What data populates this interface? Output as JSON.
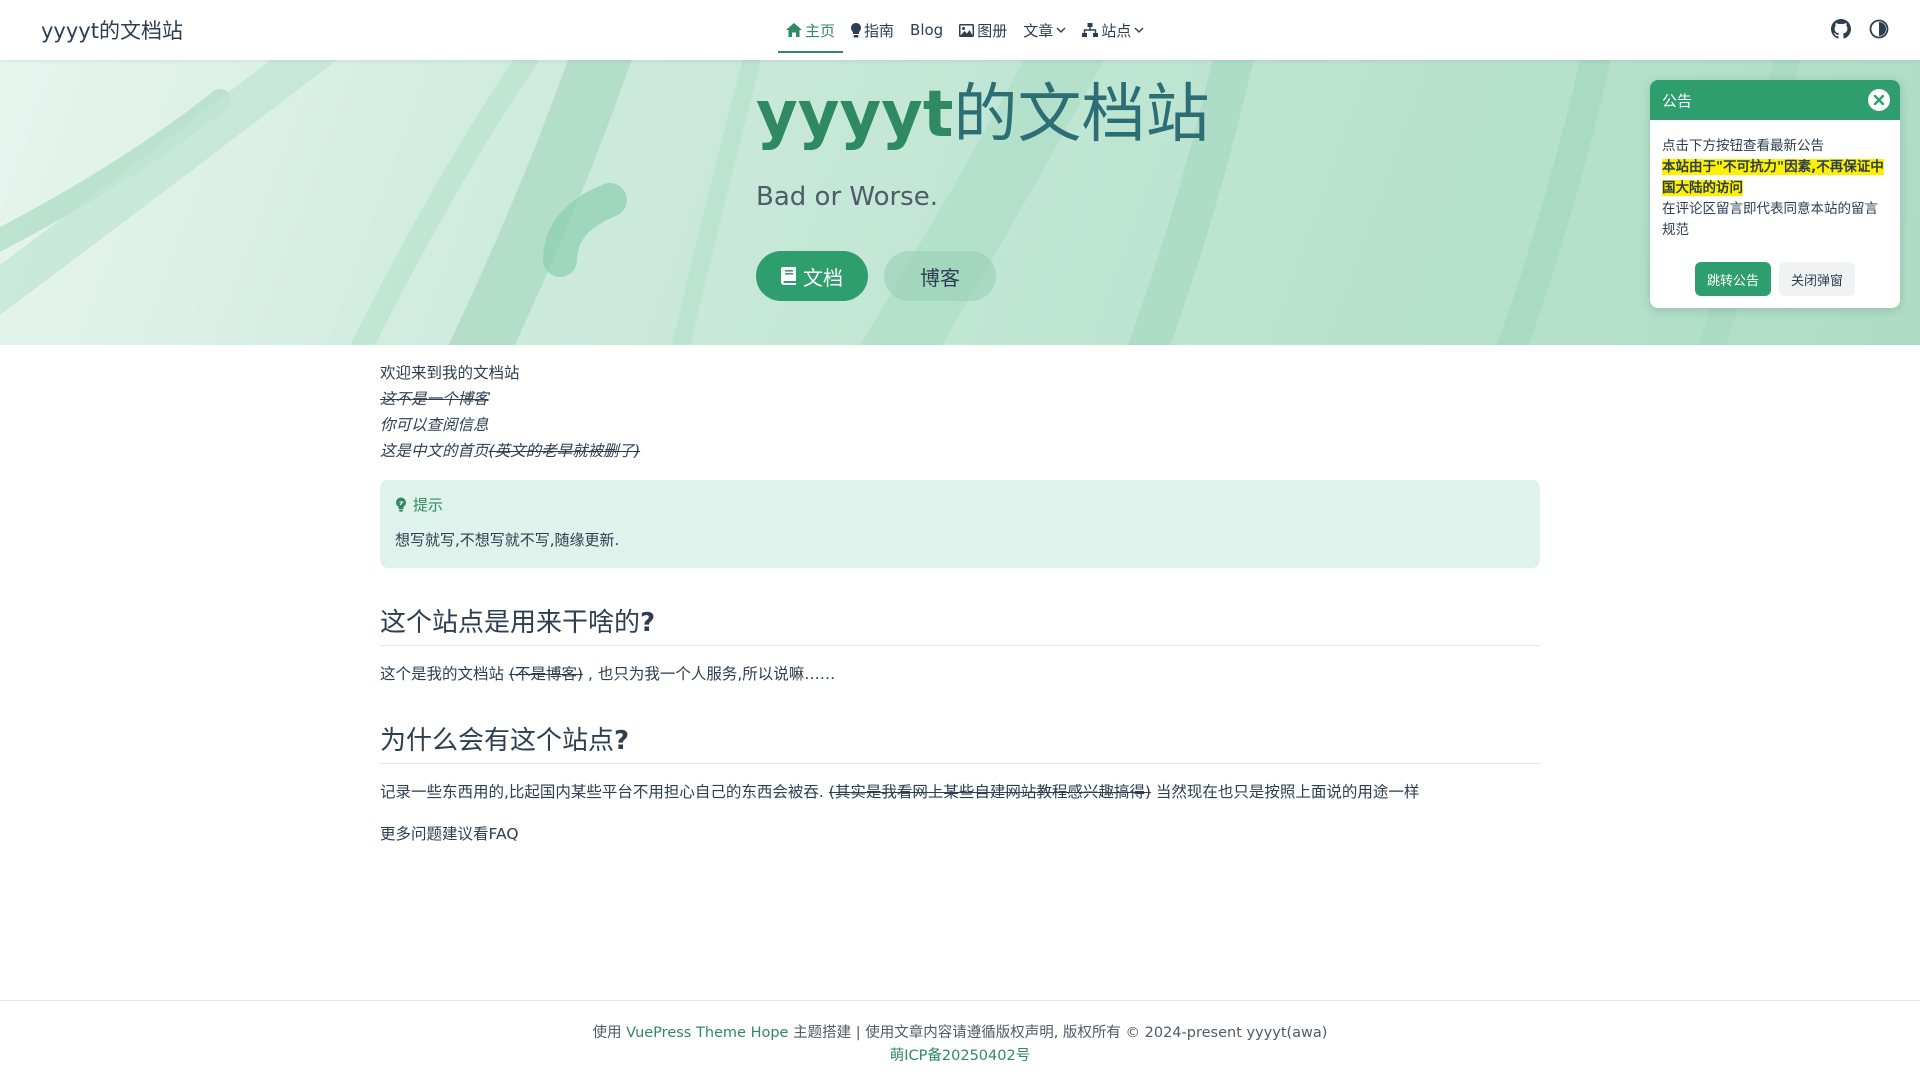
{
  "navbar": {
    "brand": "yyyyt的文档站",
    "items": [
      {
        "label": "主页",
        "icon": "home-icon",
        "active": true
      },
      {
        "label": "指南",
        "icon": "lightbulb-icon"
      },
      {
        "label": "Blog"
      },
      {
        "label": "图册",
        "icon": "image-icon"
      },
      {
        "label": "文章",
        "dropdown": true
      },
      {
        "label": "站点",
        "icon": "sitemap-icon",
        "dropdown": true
      }
    ],
    "right_icons": [
      "github-icon",
      "theme-toggle-icon"
    ]
  },
  "hero": {
    "title_bold": "yyyyt",
    "title_rest": "的文档站",
    "subtitle": "Bad or Worse.",
    "btn_doc": "文档",
    "btn_blog": "博客"
  },
  "notice": {
    "title": "公告",
    "line1": "点击下方按钮查看最新公告",
    "highlight": "本站由于\"不可抗力\"因素,不再保证中国大陆的访问",
    "line3": "在评论区留言即代表同意本站的留言规范",
    "btn_primary": "跳转公告",
    "btn_secondary": "关闭弹窗"
  },
  "content": {
    "intro1": "欢迎来到我的文档站",
    "intro2": "这不是一个博客",
    "intro3": "你可以查阅信息",
    "intro4_a": "这是中文的首页",
    "intro4_b": "(英文的老早就被删了)",
    "tip_title": "提示",
    "tip_text": "想写就写,不想写就不写,随缘更新.",
    "h2a_text": "这个站点是用来干啥的",
    "h2a_q": "?",
    "p1_a": "这个是我的文档站 ",
    "p1_b": "(不是博客)",
    "p1_c": " , 也只为我一个人服务,所以说嘛……",
    "h2b_text": "为什么会有这个站点",
    "h2b_q": "?",
    "p2_a": "记录一些东西用的,比起国内某些平台不用担心自己的东西会被吞. ",
    "p2_b": "(其实是我看网上某些自建网站教程感兴趣搞得)",
    "p2_c": " 当然现在也只是按照上面说的用途一样",
    "more": "更多问题建议看FAQ"
  },
  "footer": {
    "prefix": "使用 ",
    "theme_link": "VuePress Theme Hope",
    "suffix": " 主题搭建 | 使用文章内容请遵循版权声明, 版权所有 © 2024-present yyyyt(awa)",
    "icp": "萌ICP备20250402号"
  },
  "colors": {
    "accent": "#2f9e6f",
    "accent_dark": "#2f8a63",
    "tip_bg": "#def3eb",
    "highlight": "#fff000"
  }
}
